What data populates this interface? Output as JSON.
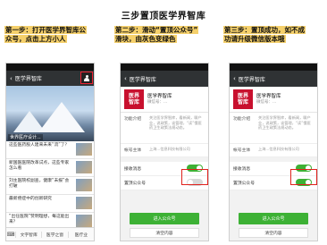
{
  "title": "三步置顶医学界智库",
  "steps": [
    {
      "line1": "第一步：打开医学界智库公",
      "line2": "众号，点击上方小人"
    },
    {
      "line1": "第二步：滑动“置顶公众号”",
      "line2": "滑块，由灰色变绿色"
    },
    {
      "line1": "第三步：置顶成功，如不成",
      "line2": "功请升级微信版本哦"
    }
  ],
  "phone1": {
    "nav_title": "医学界智库",
    "hero_caption": "世界医疗设计...",
    "news": [
      {
        "text": "这些医药股人建来未来“流”了？"
      },
      {
        "text": "新国医医院改革试点，这些专家怎么看"
      },
      {
        "text": "刘主医院校副查，健康“未报”会打破"
      },
      {
        "text": "最新癌症中的创新研究"
      },
      {
        "text": "“出任医院”赞明理想，每这能出来？"
      }
    ],
    "menu": {
      "item1": "文字智库",
      "item2": "医学之窗",
      "item3": "医疗业"
    }
  },
  "phone2": {
    "nav_title": "医学界智库",
    "logo_text": "医界\n智库",
    "account_name": "医学界智库",
    "account_id": "微信号：...",
    "row1_label": "功能介绍",
    "row1_value": "关注医学界智库，看新闻，聊产业，说政策，谈管理，“读”懂医药卫生政策法规动态。",
    "row2_label": "帐号主体",
    "row2_value": "上海...信息科技有限公司",
    "toggle1_label": "接收消息",
    "toggle2_label": "置顶公众号",
    "enter_label": "进入公众号",
    "clear_label": "清空内容"
  },
  "phone3": {
    "nav_title": "医学界智库",
    "logo_text": "医界\n智库",
    "account_name": "医学界智库",
    "account_id": "微信号：...",
    "row1_label": "功能介绍",
    "row1_value": "关注医学界智库，看新闻，聊产业，说政策，谈管理，“读”懂医药卫生政策法规动态。",
    "row2_label": "帐号主体",
    "row2_value": "上海...信息科技有限公司",
    "toggle1_label": "接收消息",
    "toggle2_label": "置顶公众号",
    "enter_label": "进入公众号",
    "clear_label": "清空内容"
  },
  "colors": {
    "wechat_green": "#3db135",
    "highlight_red": "#e0211c",
    "step_highlight": "#f5d06b",
    "brand_red": "#c8102e"
  },
  "toggle_states": {
    "phone2_receive": true,
    "phone2_pin": false,
    "phone3_receive": true,
    "phone3_pin": true
  }
}
